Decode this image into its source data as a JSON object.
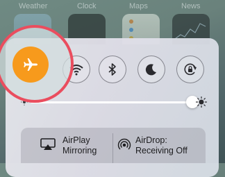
{
  "home_screen": {
    "apps": [
      {
        "label": "Weather",
        "icon": "weather-icon"
      },
      {
        "label": "Clock",
        "icon": "clock-icon"
      },
      {
        "label": "Maps",
        "icon": "maps-icon"
      },
      {
        "label": "News",
        "icon": "news-icon"
      }
    ]
  },
  "control_center": {
    "toggles": [
      {
        "name": "airplane-mode",
        "icon": "airplane-icon",
        "state": "on",
        "color": "#f79a1c"
      },
      {
        "name": "wifi",
        "icon": "wifi-icon",
        "state": "off"
      },
      {
        "name": "bluetooth",
        "icon": "bluetooth-icon",
        "state": "off"
      },
      {
        "name": "do-not-disturb",
        "icon": "moon-icon",
        "state": "off"
      },
      {
        "name": "rotation-lock",
        "icon": "rotation-lock-icon",
        "state": "off"
      }
    ],
    "brightness": {
      "level": 0.98
    },
    "airplay": {
      "line1": "AirPlay",
      "line2": "Mirroring"
    },
    "airdrop": {
      "line1": "AirDrop:",
      "line2": "Receiving Off"
    }
  },
  "annotation": {
    "highlight_color": "#ea4d5e",
    "target": "airplane-mode"
  }
}
